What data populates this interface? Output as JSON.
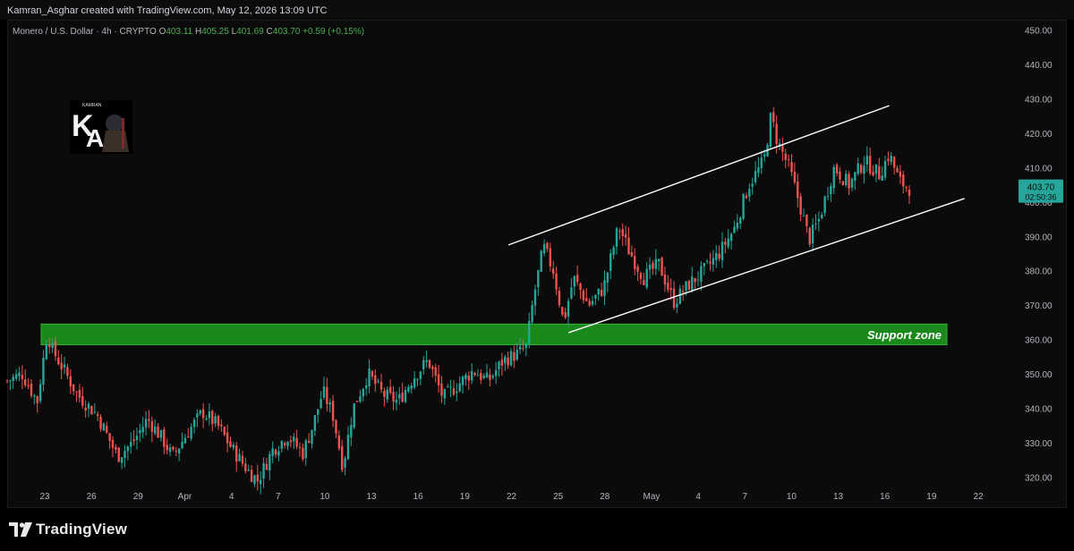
{
  "header": {
    "credit": "Kamran_Asghar created with TradingView.com, May 12, 2026 13:09 UTC"
  },
  "symbol": {
    "name": "Monero / U.S. Dollar · 4h · CRYPTO",
    "open_label": "O",
    "open": "403.11",
    "high_label": "H",
    "high": "405.25",
    "low_label": "L",
    "low": "401.69",
    "close_label": "C",
    "close": "403.70",
    "change": "+0.59 (+0.15%)"
  },
  "price_tag": {
    "price": "403.70",
    "countdown": "02:50:36",
    "color": "#26a69a"
  },
  "colors": {
    "up": "#26a69a",
    "down": "#ef5350",
    "support": "#1b8f1b",
    "background": "#0b0b0b"
  },
  "annotation": {
    "support_label": "Support zone"
  },
  "footer": {
    "brand": "TradingView"
  },
  "chart_data": {
    "type": "candlestick",
    "timeframe": "4h",
    "y_ticks": [
      "320.00",
      "330.00",
      "340.00",
      "350.00",
      "360.00",
      "370.00",
      "380.00",
      "390.00",
      "400.00",
      "410.00",
      "420.00",
      "430.00",
      "440.00",
      "450.00"
    ],
    "ylim": [
      317,
      453
    ],
    "x_ticks": [
      "23",
      "26",
      "29",
      "Apr",
      "4",
      "7",
      "10",
      "13",
      "16",
      "19",
      "22",
      "25",
      "28",
      "May",
      "4",
      "7",
      "10",
      "13",
      "16",
      "19",
      "22"
    ],
    "support_zone": {
      "low": 358.5,
      "high": 364.5
    },
    "channel": {
      "upper": {
        "from": {
          "t": 0.5,
          "price": 387.5
        },
        "to": {
          "t": 0.88,
          "price": 428
        }
      },
      "lower": {
        "from": {
          "t": 0.56,
          "price": 362
        },
        "to": {
          "t": 0.955,
          "price": 401
        }
      }
    },
    "price_path": [
      {
        "t": 0.0,
        "price": 348
      },
      {
        "t": 0.015,
        "price": 350
      },
      {
        "t": 0.03,
        "price": 342
      },
      {
        "t": 0.04,
        "price": 362
      },
      {
        "t": 0.045,
        "price": 357
      },
      {
        "t": 0.055,
        "price": 352
      },
      {
        "t": 0.07,
        "price": 344
      },
      {
        "t": 0.09,
        "price": 338
      },
      {
        "t": 0.11,
        "price": 326
      },
      {
        "t": 0.125,
        "price": 330
      },
      {
        "t": 0.14,
        "price": 337
      },
      {
        "t": 0.155,
        "price": 331
      },
      {
        "t": 0.165,
        "price": 326
      },
      {
        "t": 0.18,
        "price": 333
      },
      {
        "t": 0.195,
        "price": 339
      },
      {
        "t": 0.21,
        "price": 335
      },
      {
        "t": 0.225,
        "price": 328
      },
      {
        "t": 0.24,
        "price": 322
      },
      {
        "t": 0.25,
        "price": 319
      },
      {
        "t": 0.265,
        "price": 328
      },
      {
        "t": 0.28,
        "price": 332
      },
      {
        "t": 0.295,
        "price": 327
      },
      {
        "t": 0.305,
        "price": 335
      },
      {
        "t": 0.315,
        "price": 345
      },
      {
        "t": 0.325,
        "price": 338
      },
      {
        "t": 0.335,
        "price": 323
      },
      {
        "t": 0.345,
        "price": 340
      },
      {
        "t": 0.36,
        "price": 350
      },
      {
        "t": 0.375,
        "price": 344
      },
      {
        "t": 0.39,
        "price": 342
      },
      {
        "t": 0.405,
        "price": 349
      },
      {
        "t": 0.42,
        "price": 354
      },
      {
        "t": 0.435,
        "price": 343
      },
      {
        "t": 0.45,
        "price": 347
      },
      {
        "t": 0.465,
        "price": 351
      },
      {
        "t": 0.48,
        "price": 348
      },
      {
        "t": 0.495,
        "price": 354
      },
      {
        "t": 0.51,
        "price": 356
      },
      {
        "t": 0.518,
        "price": 358
      },
      {
        "t": 0.525,
        "price": 372
      },
      {
        "t": 0.535,
        "price": 387
      },
      {
        "t": 0.545,
        "price": 380
      },
      {
        "t": 0.555,
        "price": 365
      },
      {
        "t": 0.565,
        "price": 378
      },
      {
        "t": 0.58,
        "price": 370
      },
      {
        "t": 0.595,
        "price": 375
      },
      {
        "t": 0.61,
        "price": 393
      },
      {
        "t": 0.62,
        "price": 386
      },
      {
        "t": 0.635,
        "price": 378
      },
      {
        "t": 0.65,
        "price": 382
      },
      {
        "t": 0.665,
        "price": 371
      },
      {
        "t": 0.68,
        "price": 376
      },
      {
        "t": 0.695,
        "price": 380
      },
      {
        "t": 0.71,
        "price": 385
      },
      {
        "t": 0.725,
        "price": 392
      },
      {
        "t": 0.74,
        "price": 405
      },
      {
        "t": 0.755,
        "price": 412
      },
      {
        "t": 0.762,
        "price": 425
      },
      {
        "t": 0.768,
        "price": 418
      },
      {
        "t": 0.78,
        "price": 410
      },
      {
        "t": 0.79,
        "price": 400
      },
      {
        "t": 0.8,
        "price": 389
      },
      {
        "t": 0.81,
        "price": 395
      },
      {
        "t": 0.825,
        "price": 410
      },
      {
        "t": 0.84,
        "price": 405
      },
      {
        "t": 0.855,
        "price": 412
      },
      {
        "t": 0.87,
        "price": 408
      },
      {
        "t": 0.88,
        "price": 414
      },
      {
        "t": 0.89,
        "price": 406
      },
      {
        "t": 0.9,
        "price": 404
      }
    ]
  }
}
